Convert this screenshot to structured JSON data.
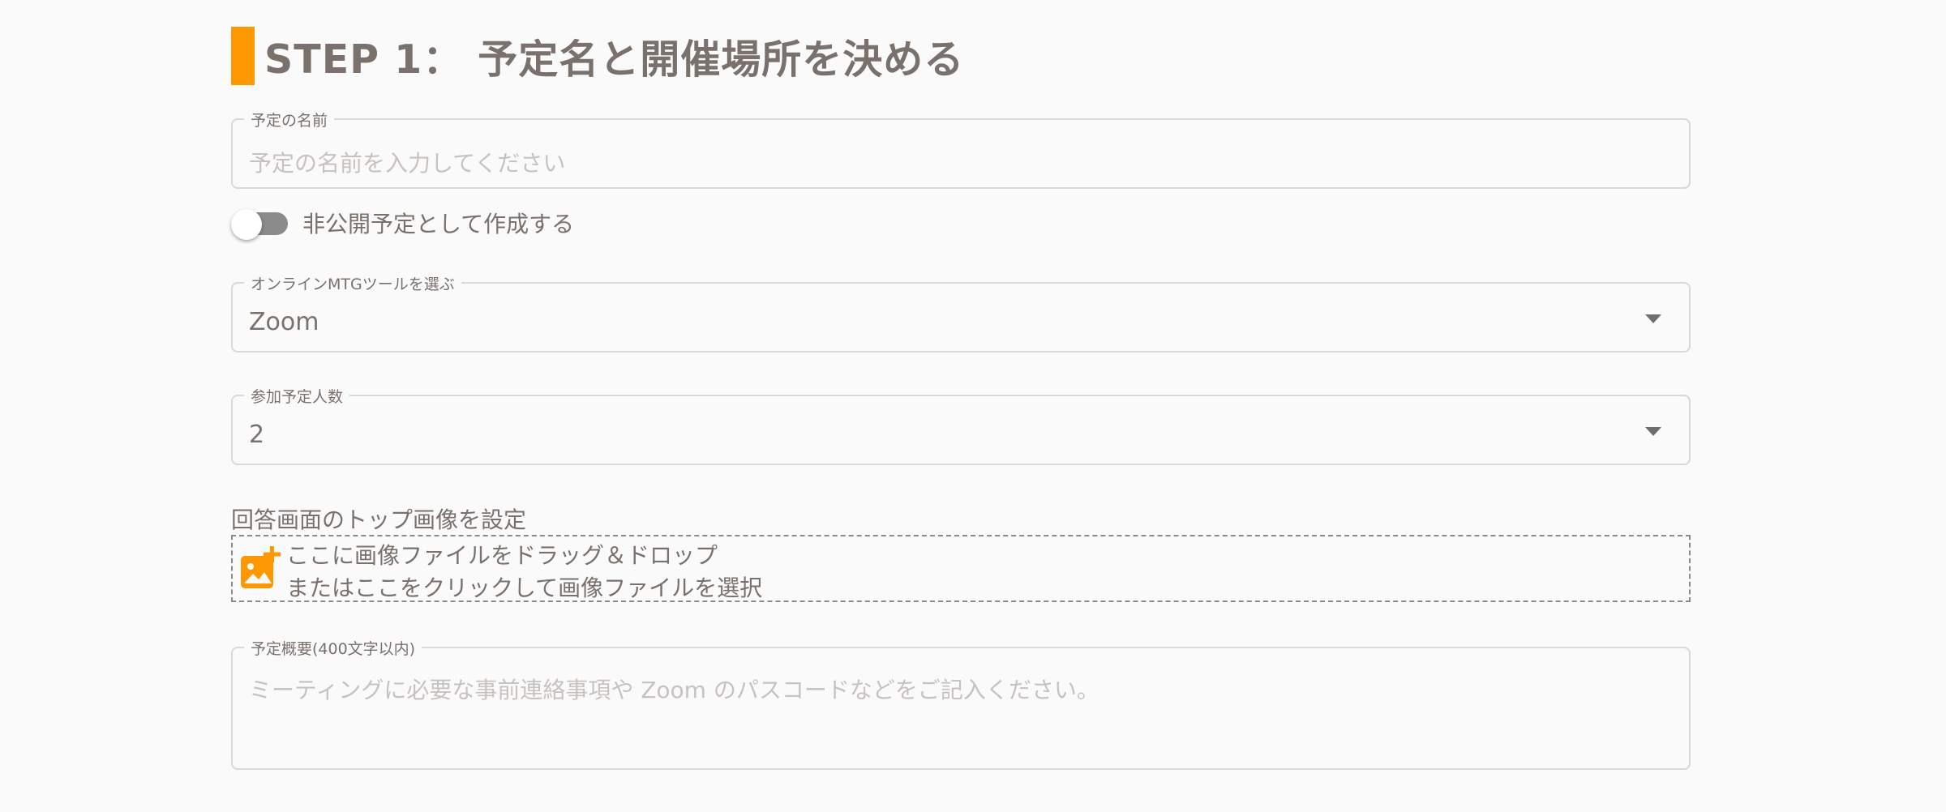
{
  "step": {
    "title": "STEP 1： 予定名と開催場所を決める",
    "accent_color": "#ff9800"
  },
  "event_name": {
    "label": "予定の名前",
    "placeholder": "予定の名前を入力してください"
  },
  "private_toggle": {
    "label": "非公開予定として作成する",
    "state": "off"
  },
  "online_tool": {
    "label": "オンラインMTGツールを選ぶ",
    "value": "Zoom"
  },
  "participants": {
    "label": "参加予定人数",
    "value": "2"
  },
  "top_image": {
    "label": "回答画面のトップ画像を設定",
    "drop_line1": "ここに画像ファイルをドラッグ＆ドロップ",
    "drop_line2": "またはここをクリックして画像ファイルを選択",
    "icon": "add-image-icon"
  },
  "summary": {
    "label": "予定概要(400文字以内)",
    "placeholder": "ミーティングに必要な事前連絡事項や Zoom のパスコードなどをご記入ください。"
  }
}
